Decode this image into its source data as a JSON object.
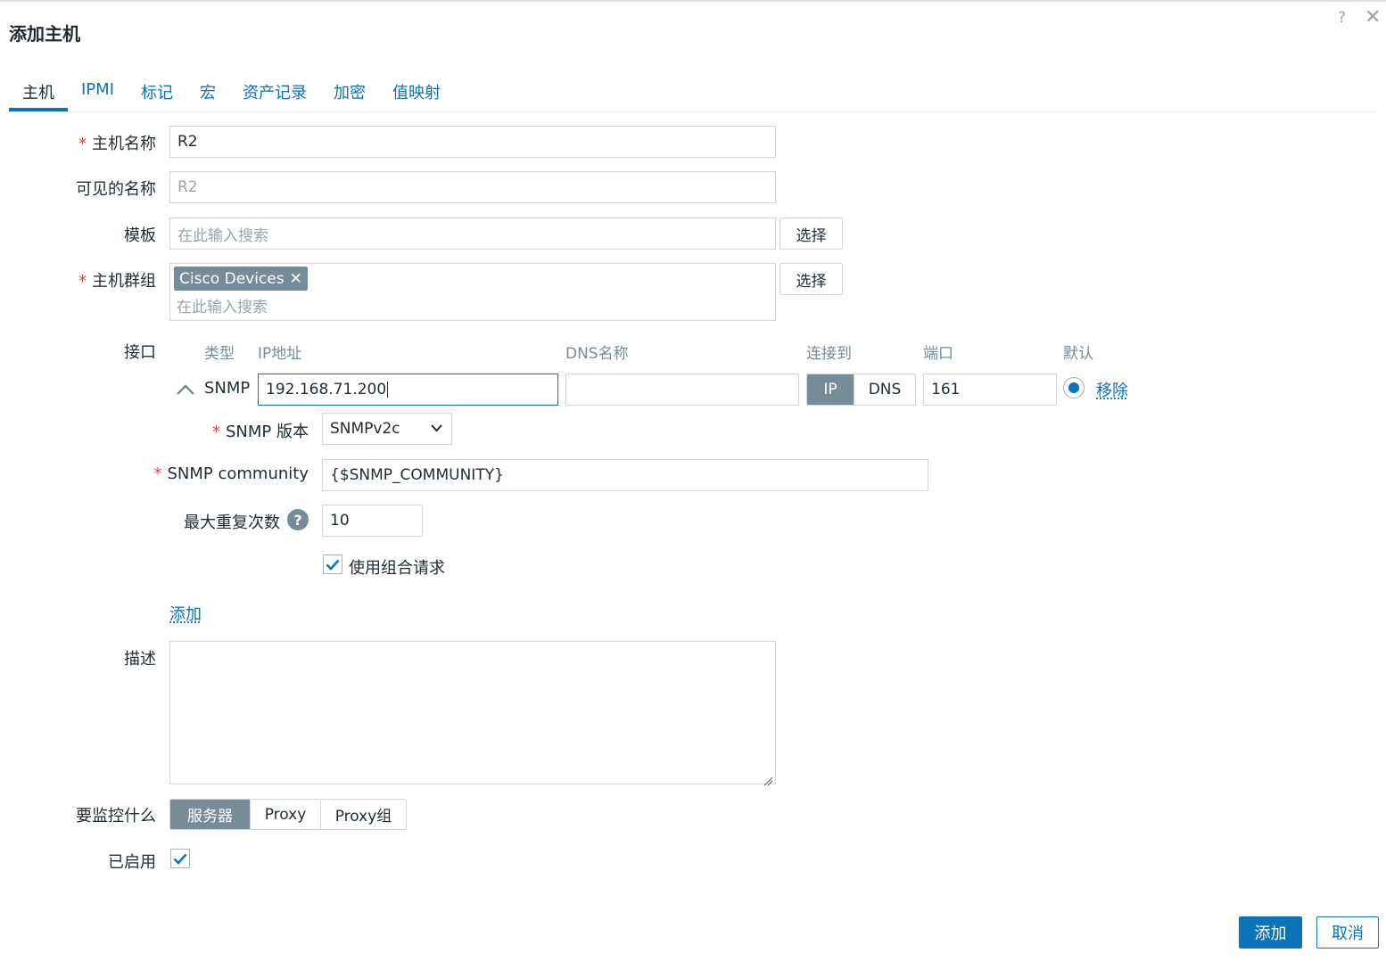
{
  "dialog": {
    "title": "添加主机",
    "help_icon": "?",
    "close_icon": "✕"
  },
  "tabs": [
    {
      "label": "主机",
      "active": true
    },
    {
      "label": "IPMI"
    },
    {
      "label": "标记"
    },
    {
      "label": "宏"
    },
    {
      "label": "资产记录"
    },
    {
      "label": "加密"
    },
    {
      "label": "值映射"
    }
  ],
  "form": {
    "host_name": {
      "label": "主机名称",
      "value": "R2",
      "required": true
    },
    "visible_name": {
      "label": "可见的名称",
      "placeholder": "R2"
    },
    "templates": {
      "label": "模板",
      "placeholder": "在此输入搜索",
      "select_label": "选择"
    },
    "host_groups": {
      "label": "主机群组",
      "chip": "Cisco Devices",
      "placeholder": "在此输入搜索",
      "select_label": "选择",
      "required": true
    },
    "interfaces": {
      "label": "接口",
      "columns": {
        "type": "类型",
        "ip": "IP地址",
        "dns": "DNS名称",
        "connect_to": "连接到",
        "port": "端口",
        "default": "默认"
      },
      "row": {
        "type": "SNMP",
        "ip": "192.168.71.200",
        "dns": "",
        "connect_ip": "IP",
        "connect_dns": "DNS",
        "connect_selected": "IP",
        "port": "161",
        "default": true,
        "remove": "移除"
      },
      "snmp_version": {
        "label": "SNMP 版本",
        "value": "SNMPv2c"
      },
      "snmp_community": {
        "label": "SNMP community",
        "value": "{$SNMP_COMMUNITY}"
      },
      "max_repetitions": {
        "label": "最大重复次数",
        "help": "?",
        "value": "10"
      },
      "bulk": {
        "label": "使用组合请求",
        "checked": true
      },
      "add": "添加"
    },
    "description": {
      "label": "描述",
      "value": ""
    },
    "monitored_by": {
      "label": "要监控什么",
      "options": [
        "服务器",
        "Proxy",
        "Proxy组"
      ],
      "selected": "服务器"
    },
    "enabled": {
      "label": "已启用",
      "checked": true
    }
  },
  "footer": {
    "add": "添加",
    "cancel": "取消"
  },
  "colors": {
    "accent": "#0b74b8",
    "required": "#d64541",
    "segment_active": "#768d99"
  }
}
